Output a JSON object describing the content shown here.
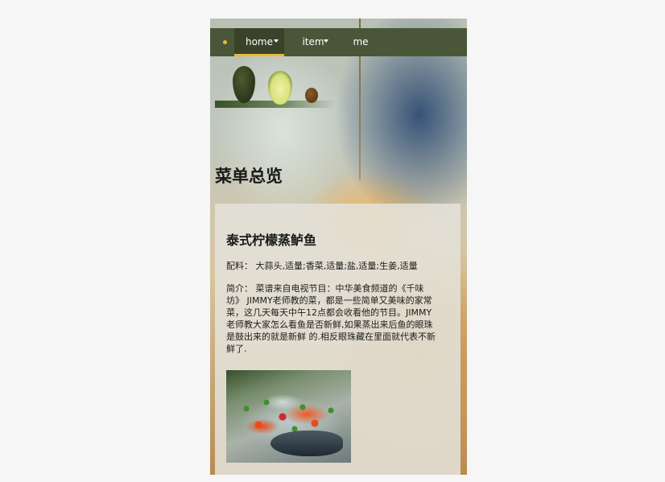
{
  "nav": {
    "items": [
      {
        "label": "home",
        "active": true,
        "has_dropdown": true
      },
      {
        "label": "item",
        "active": false,
        "has_dropdown": true
      },
      {
        "label": "me",
        "active": false,
        "has_dropdown": false
      }
    ],
    "accent_color": "#e9b93c",
    "bg_color": "#4a5638"
  },
  "hero": {
    "title": "菜单总览"
  },
  "recipe": {
    "title": "泰式柠檬蒸鲈鱼",
    "ingredients_label": "配料：",
    "ingredients": "大蒜头,适量;香菜,适量;盐,适量;生姜,适量",
    "intro_label": "简介：",
    "intro": "菜谱来自电视节目：中华美食频道的《千味坊》 JIMMY老师教的菜，都是一些简单又美味的家常菜，这几天每天中午12点都会收看他的节目。JIMMY老师教大家怎么看鱼是否新鲜,如果蒸出来后鱼的眼珠是鼓出来的就是新鲜 的.相反眼珠藏在里面就代表不新鲜了."
  }
}
